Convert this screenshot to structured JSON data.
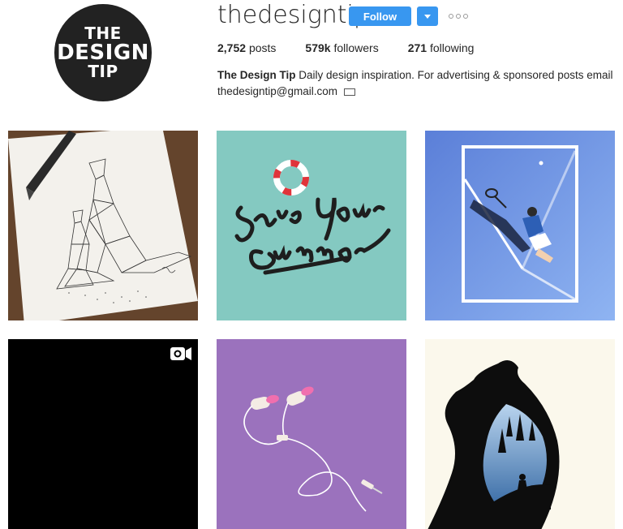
{
  "profile": {
    "avatar_lines": [
      "THE",
      "DESIGN",
      "TIP"
    ],
    "username": "thedesigntip",
    "follow_label": "Follow",
    "stats": {
      "posts_count": "2,752",
      "posts_label": "posts",
      "followers_count": "579k",
      "followers_label": "followers",
      "following_count": "271",
      "following_label": "following"
    },
    "bio_name": "The Design Tip",
    "bio_text": "Daily design inspiration. For advertising & sponsored posts email thedesigntip@gmail.com",
    "bio_icon": "envelope-icon"
  },
  "colors": {
    "accent": "#3897f0",
    "tile_teal": "#84c9c1",
    "tile_blue": "#6b8fe0",
    "tile_purple": "#9b72bd",
    "tile_cream": "#fbf8ec"
  },
  "posts": [
    {
      "subject": "geometric kangaroo sketch"
    },
    {
      "subject": "Save Your Summer lettering"
    },
    {
      "subject": "tennis player illustration"
    },
    {
      "subject": "video post",
      "icon": "video-camera-icon"
    },
    {
      "subject": "earphones illustration"
    },
    {
      "subject": "bear silhouette landscape"
    }
  ]
}
